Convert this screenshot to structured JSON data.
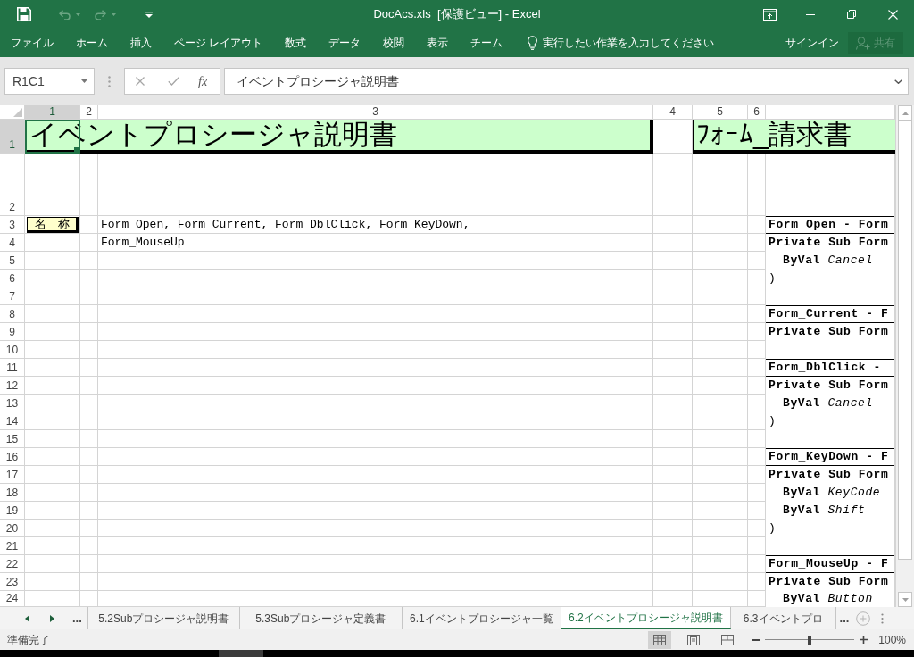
{
  "window": {
    "title": "DocAcs.xls  [保護ビュー] - Excel"
  },
  "ribbon": {
    "tabs": [
      "ファイル",
      "ホーム",
      "挿入",
      "ページ レイアウト",
      "数式",
      "データ",
      "校閲",
      "表示",
      "チーム"
    ],
    "tell_me": {
      "placeholder": "実行したい作業を入力してください"
    },
    "sign_in": "サインイン",
    "share": {
      "label": "共有",
      "disabled": true
    }
  },
  "formula_bar": {
    "name_box": "R1C1",
    "function_button": "fx",
    "formula": "イベントプロシージャ説明書"
  },
  "sheet": {
    "columns": [
      {
        "label": "1",
        "selected": true
      },
      {
        "label": "2",
        "selected": false
      },
      {
        "label": "3",
        "selected": false
      },
      {
        "label": "4",
        "selected": false
      },
      {
        "label": "5",
        "selected": false
      },
      {
        "label": "6",
        "selected": false
      }
    ],
    "rows": [
      {
        "label": "1",
        "selected": true
      },
      {
        "label": "2",
        "selected": false
      },
      {
        "label": "3",
        "selected": false
      },
      {
        "label": "4",
        "selected": false
      },
      {
        "label": "5",
        "selected": false
      },
      {
        "label": "6",
        "selected": false
      },
      {
        "label": "7",
        "selected": false
      },
      {
        "label": "8",
        "selected": false
      },
      {
        "label": "9",
        "selected": false
      },
      {
        "label": "10",
        "selected": false
      },
      {
        "label": "11",
        "selected": false
      },
      {
        "label": "12",
        "selected": false
      },
      {
        "label": "13",
        "selected": false
      },
      {
        "label": "14",
        "selected": false
      },
      {
        "label": "15",
        "selected": false
      },
      {
        "label": "16",
        "selected": false
      },
      {
        "label": "17",
        "selected": false
      },
      {
        "label": "18",
        "selected": false
      },
      {
        "label": "19",
        "selected": false
      },
      {
        "label": "20",
        "selected": false
      },
      {
        "label": "21",
        "selected": false
      },
      {
        "label": "22",
        "selected": false
      },
      {
        "label": "23",
        "selected": false
      },
      {
        "label": "24",
        "selected": false
      }
    ],
    "title_banners": [
      "イベントプロシージャ説明書",
      "ﾌｫｰﾑ_請求書"
    ],
    "name_label": "名　称",
    "name_lines": [
      "Form_Open, Form_Current, Form_DblClick, Form_KeyDown,",
      "Form_MouseUp"
    ],
    "code_lines": [
      {
        "kind": "heading",
        "text": "Form_Open - Form"
      },
      {
        "kind": "signature",
        "text": "Private Sub Form"
      },
      {
        "kind": "param",
        "keyword": "ByVal",
        "name": "Cancel"
      },
      {
        "kind": "close",
        "text": ")"
      },
      {
        "kind": "blank"
      },
      {
        "kind": "heading",
        "text": "Form_Current - F"
      },
      {
        "kind": "signature",
        "text": "Private Sub Form"
      },
      {
        "kind": "blank"
      },
      {
        "kind": "heading",
        "text": "Form_DblClick -"
      },
      {
        "kind": "signature",
        "text": "Private Sub Form"
      },
      {
        "kind": "param",
        "keyword": "ByVal",
        "name": "Cancel"
      },
      {
        "kind": "close",
        "text": ")"
      },
      {
        "kind": "blank"
      },
      {
        "kind": "heading",
        "text": "Form_KeyDown - F"
      },
      {
        "kind": "signature",
        "text": "Private Sub Form"
      },
      {
        "kind": "param",
        "keyword": "ByVal",
        "name": "KeyCode"
      },
      {
        "kind": "param",
        "keyword": "ByVal",
        "name": "Shift"
      },
      {
        "kind": "close",
        "text": ")"
      },
      {
        "kind": "blank"
      },
      {
        "kind": "heading",
        "text": "Form_MouseUp - F"
      },
      {
        "kind": "signature",
        "text": "Private Sub Form"
      },
      {
        "kind": "param",
        "keyword": "ByVal",
        "name": "Button"
      }
    ]
  },
  "sheet_tabs": {
    "more_left": "...",
    "tabs": [
      {
        "label": "5.2Subプロシージャ説明書",
        "selected": false
      },
      {
        "label": "5.3Subプロシージャ定義書",
        "selected": false
      },
      {
        "label": "6.1イベントプロシージャ一覧",
        "selected": false
      },
      {
        "label": "6.2イベントプロシージャ説明書",
        "selected": true
      },
      {
        "label": "6.3イベントプロ",
        "selected": false
      }
    ],
    "more_right": "..."
  },
  "status_bar": {
    "status": "準備完了",
    "views": [
      {
        "kind": "normal",
        "selected": true
      },
      {
        "kind": "page_layout",
        "selected": false
      },
      {
        "kind": "page_break",
        "selected": false
      }
    ],
    "zoom": {
      "level": 0.5,
      "reading": "100%"
    }
  }
}
